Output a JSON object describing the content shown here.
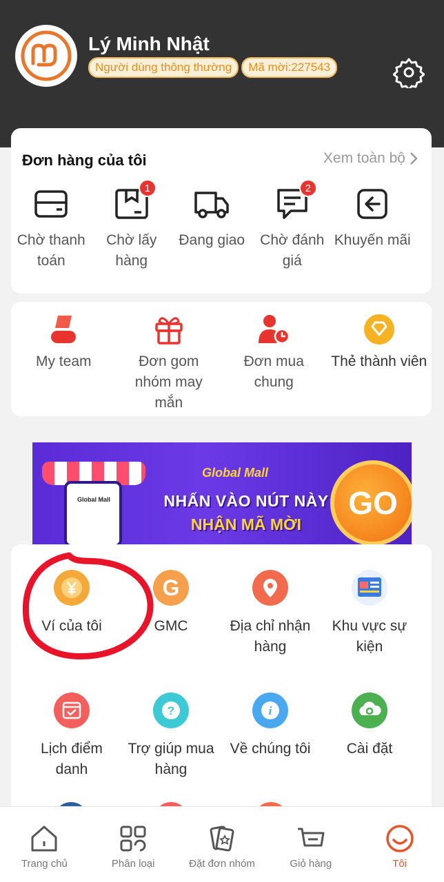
{
  "profile": {
    "name": "Lý Minh Nhật",
    "user_type": "Người dùng thông thường",
    "invite_code": "Mã mời:227543"
  },
  "orders": {
    "title": "Đơn hàng của tôi",
    "see_all": "Xem toàn bộ",
    "items": [
      {
        "label": "Chờ thanh toán",
        "icon": "wallet-card-icon",
        "badge": ""
      },
      {
        "label": "Chờ lấy hàng",
        "icon": "package-box-icon",
        "badge": "1"
      },
      {
        "label": "Đang giao",
        "icon": "delivery-truck-icon",
        "badge": ""
      },
      {
        "label": "Chờ đánh giá",
        "icon": "review-chat-icon",
        "badge": "2"
      },
      {
        "label": "Khuyến mãi",
        "icon": "promotion-return-icon",
        "badge": ""
      }
    ]
  },
  "group": {
    "items": [
      {
        "label": "My team",
        "icon": "team-person-icon"
      },
      {
        "label": "Đơn gom nhóm may mắn",
        "icon": "gift-box-icon"
      },
      {
        "label": "Đơn mua chung",
        "icon": "group-buy-clock-icon"
      },
      {
        "label": "Thẻ thành viên",
        "icon": "member-diamond-icon"
      }
    ]
  },
  "banner": {
    "brand": "Global Mall",
    "phone_brand": "Global Mall",
    "line1": "NHẤN VÀO NÚT NÀY",
    "line2": "NHẬN MÃ MỜI",
    "go": "GO"
  },
  "tools": {
    "items": [
      {
        "label": "Ví của tôi",
        "icon": "yen-coin-icon",
        "color": "#f6a93b"
      },
      {
        "label": "GMC",
        "icon": "gmc-g-icon",
        "color": "#f6a04d"
      },
      {
        "label": "Địa chỉ nhận hàng",
        "icon": "location-pin-icon",
        "color": "#f26b4f"
      },
      {
        "label": "Khu vực sự kiện",
        "icon": "event-screen-icon",
        "color": "#3a7be0"
      },
      {
        "label": "Lịch điểm danh",
        "icon": "calendar-check-icon",
        "color": "#f25f5c"
      },
      {
        "label": "Trợ giúp mua hàng",
        "icon": "help-question-icon",
        "color": "#3ec9d6"
      },
      {
        "label": "Về chúng tôi",
        "icon": "info-icon",
        "color": "#4aa8f0"
      },
      {
        "label": "Cài đặt",
        "icon": "cloud-gear-icon",
        "color": "#4caf50"
      }
    ]
  },
  "tabbar": {
    "items": [
      {
        "label": "Trang chủ",
        "icon": "home-icon",
        "active": false
      },
      {
        "label": "Phân loại",
        "icon": "category-grid-icon",
        "active": false
      },
      {
        "label": "Đặt đơn nhóm",
        "icon": "group-order-cards-icon",
        "active": false
      },
      {
        "label": "Giỏ hàng",
        "icon": "shopping-cart-icon",
        "active": false
      },
      {
        "label": "Tôi",
        "icon": "me-smile-icon",
        "active": true
      }
    ]
  },
  "colors": {
    "header_bg": "#333333",
    "accent": "#e8532a",
    "badge_border": "#f2b75a",
    "badge_text": "#e88f1f",
    "notification": "#e8342f",
    "annotation_circle": "#e8142a"
  }
}
